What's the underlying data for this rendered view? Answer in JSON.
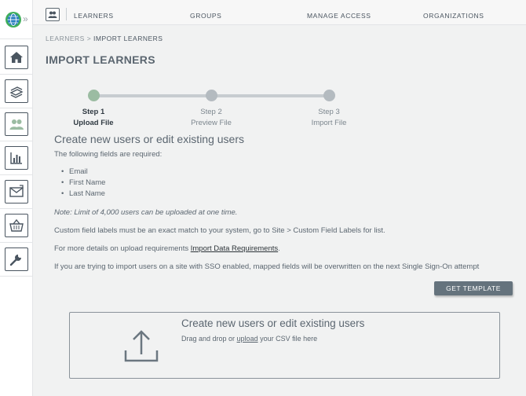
{
  "topnav": {
    "links": [
      "LEARNERS",
      "GROUPS",
      "MANAGE ACCESS",
      "ORGANIZATIONS"
    ]
  },
  "sidebar": {
    "expand": "»",
    "items": [
      "home-icon",
      "courses-icon",
      "users-icon",
      "reports-icon",
      "messages-icon",
      "store-icon",
      "tools-icon"
    ]
  },
  "breadcrumb": {
    "parent": "LEARNERS",
    "sep": ">",
    "current": "IMPORT LEARNERS"
  },
  "page": {
    "title": "IMPORT LEARNERS"
  },
  "steps": [
    {
      "step": "Step 1",
      "label": "Upload File",
      "active": true
    },
    {
      "step": "Step 2",
      "label": "Preview File",
      "active": false
    },
    {
      "step": "Step 3",
      "label": "Import File",
      "active": false
    }
  ],
  "content": {
    "heading": "Create new users or edit existing users",
    "required_intro": "The following fields are required:",
    "required_fields": [
      "Email",
      "First Name",
      "Last Name"
    ],
    "note": "Note: Limit of 4,000 users can be uploaded at one time.",
    "custom_fields": "Custom field labels must be an exact match to your system, go to Site > Custom Field Labels for list.",
    "details_prefix": "For more details on upload requirements ",
    "details_link": "Import Data Requirements",
    "details_suffix": ".",
    "sso": "If you are trying to import users on a site with SSO enabled, mapped fields will be overwritten on the next Single Sign-On attempt"
  },
  "get_template": "GET TEMPLATE",
  "dropzone": {
    "title": "Create new users or edit existing users",
    "prefix": "Drag and drop or ",
    "link": "upload",
    "suffix": " your CSV file here"
  },
  "colors": {
    "active_step": "#9bbca2",
    "inactive_step": "#b4bbc0",
    "button": "#65737d"
  }
}
